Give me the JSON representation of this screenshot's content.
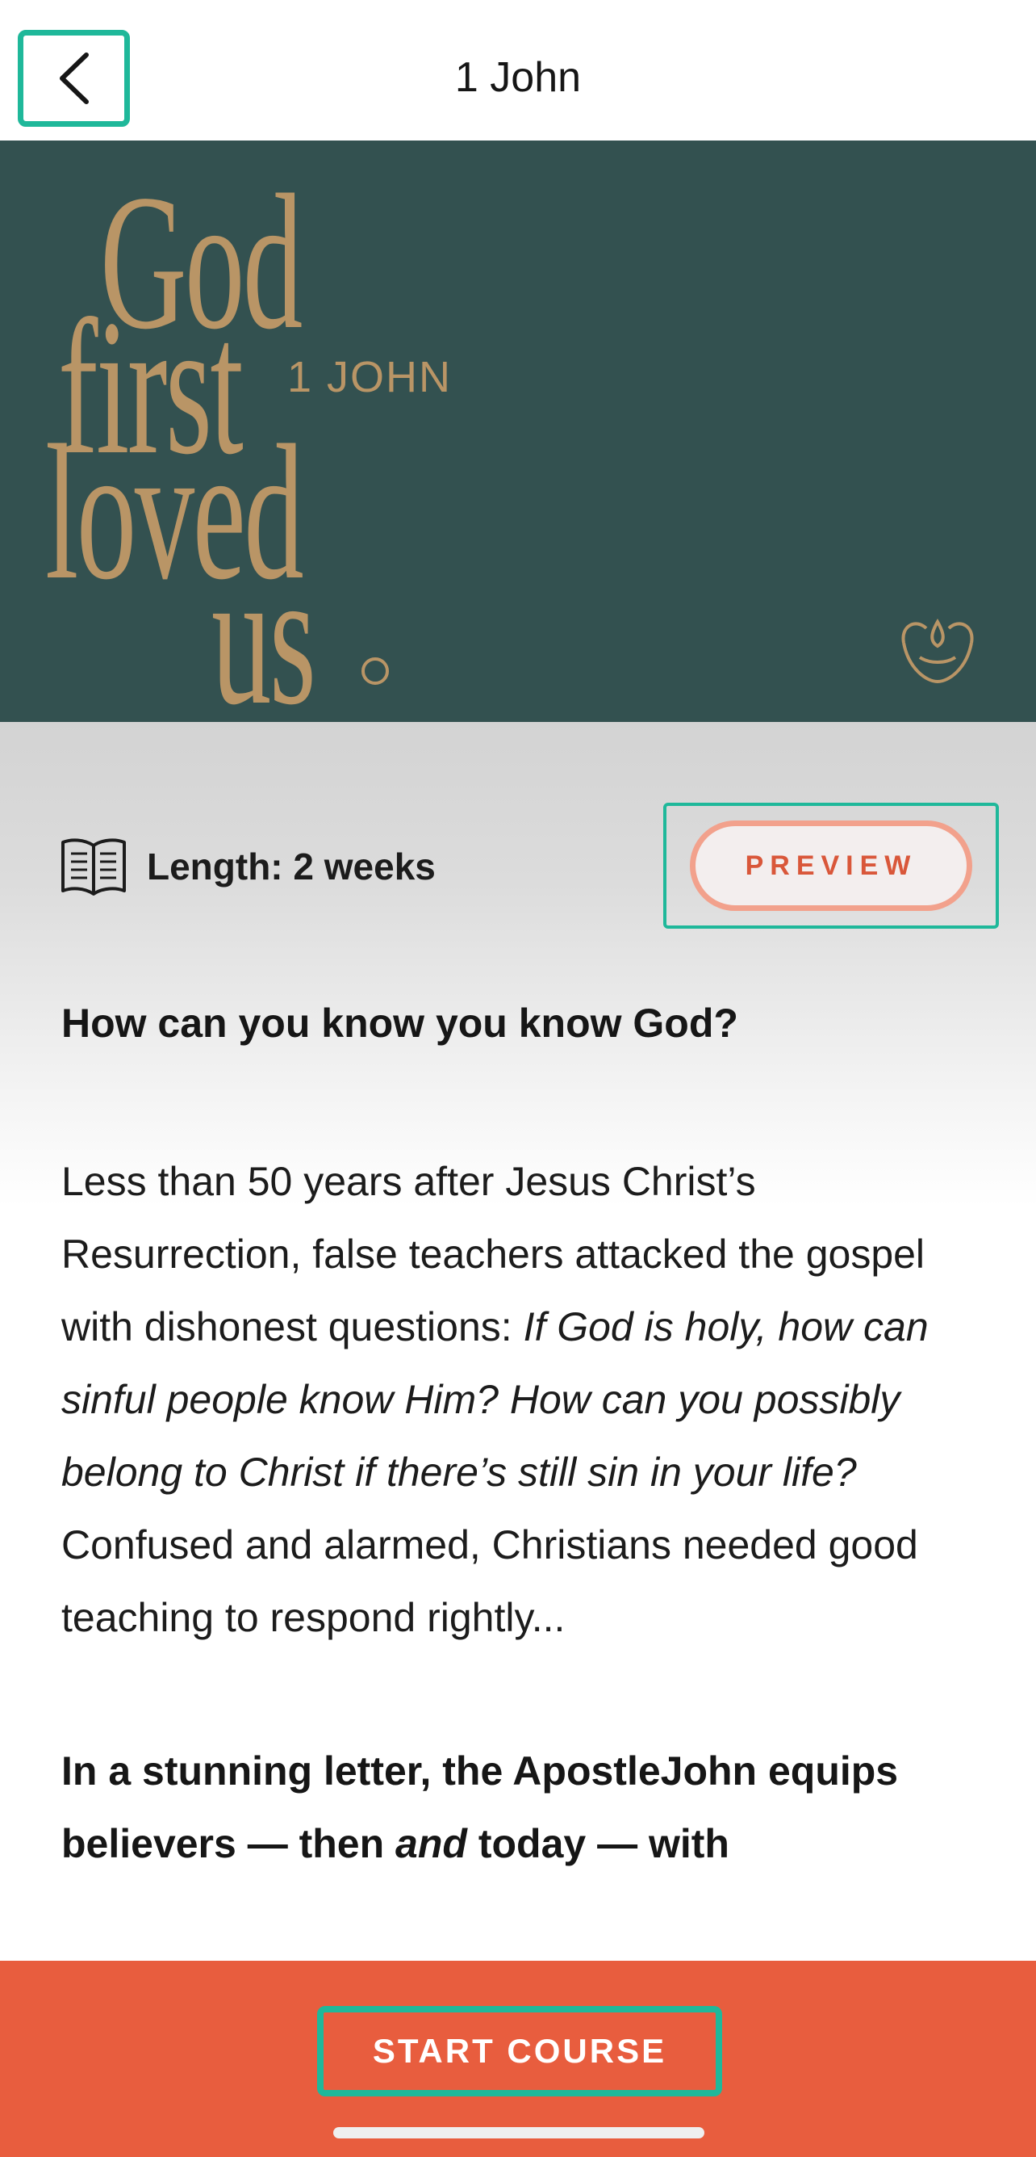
{
  "header": {
    "title": "1 John",
    "back_icon": "chevron-left-icon"
  },
  "hero": {
    "title_words": [
      "God",
      "first",
      "loved",
      "us"
    ],
    "subtitle": "1 JOHN",
    "logo_icon": "brand-logo-icon",
    "background_color": "#335150",
    "text_color": "#b99566"
  },
  "meta": {
    "length_icon": "book-icon",
    "length_label": "Length: 2 weeks",
    "preview_label": "PREVIEW"
  },
  "content": {
    "question": "How can you know you know God?",
    "para_intro": "Less than 50 years after Jesus Christ’s Resurrection, false teachers attacked the gospel with dishonest questions: ",
    "para_italic": "If God is holy, how can sinful people know Him? How can you possibly belong to Christ if there’s still sin in your life?",
    "para_outro": " Confused and alarmed, Christians needed good teaching to respond rightly...",
    "bold_start": "In a stunning letter, the ApostleJohn equips believers — then ",
    "bold_italic": "and",
    "bold_end": " today — with"
  },
  "footer": {
    "start_label": "START COURSE",
    "accent_color": "#e85d3e"
  }
}
